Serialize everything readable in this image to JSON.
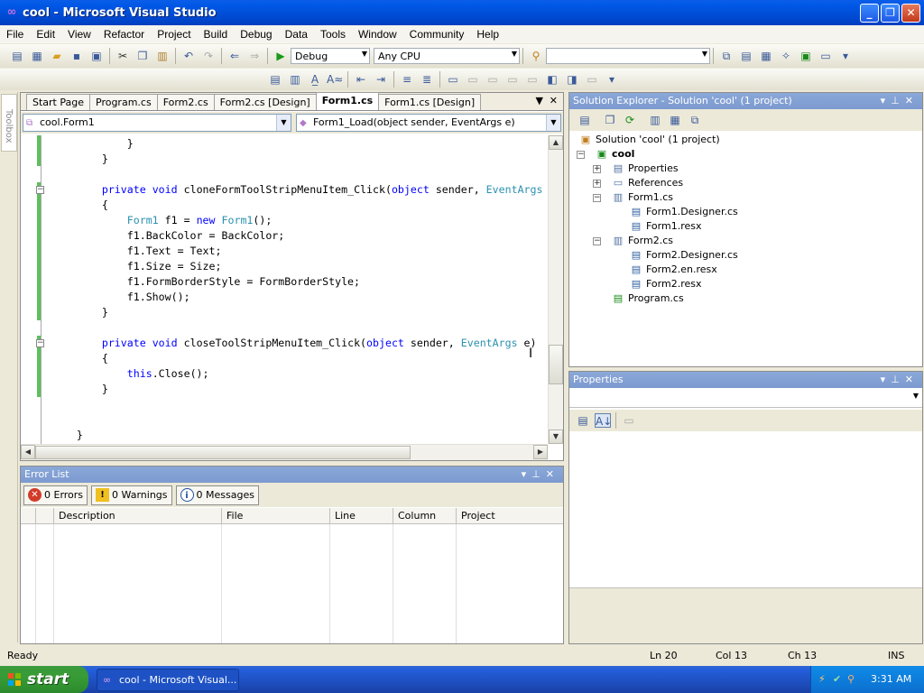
{
  "window": {
    "title": "cool - Microsoft Visual Studio"
  },
  "menu": [
    "File",
    "Edit",
    "View",
    "Refactor",
    "Project",
    "Build",
    "Debug",
    "Data",
    "Tools",
    "Window",
    "Community",
    "Help"
  ],
  "toolbar": {
    "config": "Debug",
    "platform": "Any CPU",
    "find_value": ""
  },
  "toolbox": {
    "label": "Toolbox"
  },
  "editor": {
    "tabs": [
      "Start Page",
      "Program.cs",
      "Form2.cs",
      "Form2.cs [Design]",
      "Form1.cs",
      "Form1.cs [Design]"
    ],
    "active_tab": "Form1.cs",
    "class_combo": "cool.Form1",
    "member_combo": "Form1_Load(object sender, EventArgs e)"
  },
  "error_list": {
    "title": "Error List",
    "errors": "0 Errors",
    "warnings": "0 Warnings",
    "messages": "0 Messages",
    "columns": [
      "Description",
      "File",
      "Line",
      "Column",
      "Project"
    ]
  },
  "solution_explorer": {
    "title": "Solution Explorer - Solution 'cool' (1 project)",
    "nodes": [
      "Solution 'cool' (1 project)",
      "cool",
      "Properties",
      "References",
      "Form1.cs",
      "Form1.Designer.cs",
      "Form1.resx",
      "Form2.cs",
      "Form2.Designer.cs",
      "Form2.en.resx",
      "Form2.resx",
      "Program.cs"
    ]
  },
  "properties": {
    "title": "Properties"
  },
  "status": {
    "text": "Ready",
    "ln": "Ln 20",
    "col": "Col 13",
    "ch": "Ch 13",
    "mode": "INS"
  },
  "taskbar": {
    "start": "start",
    "item": "cool - Microsoft Visual...",
    "clock": "3:31 AM"
  },
  "colors": {
    "keyword": "#0000ff",
    "type": "#2b91af",
    "panel_title": "#7d9ad0",
    "titlebar": "#0058e6"
  }
}
